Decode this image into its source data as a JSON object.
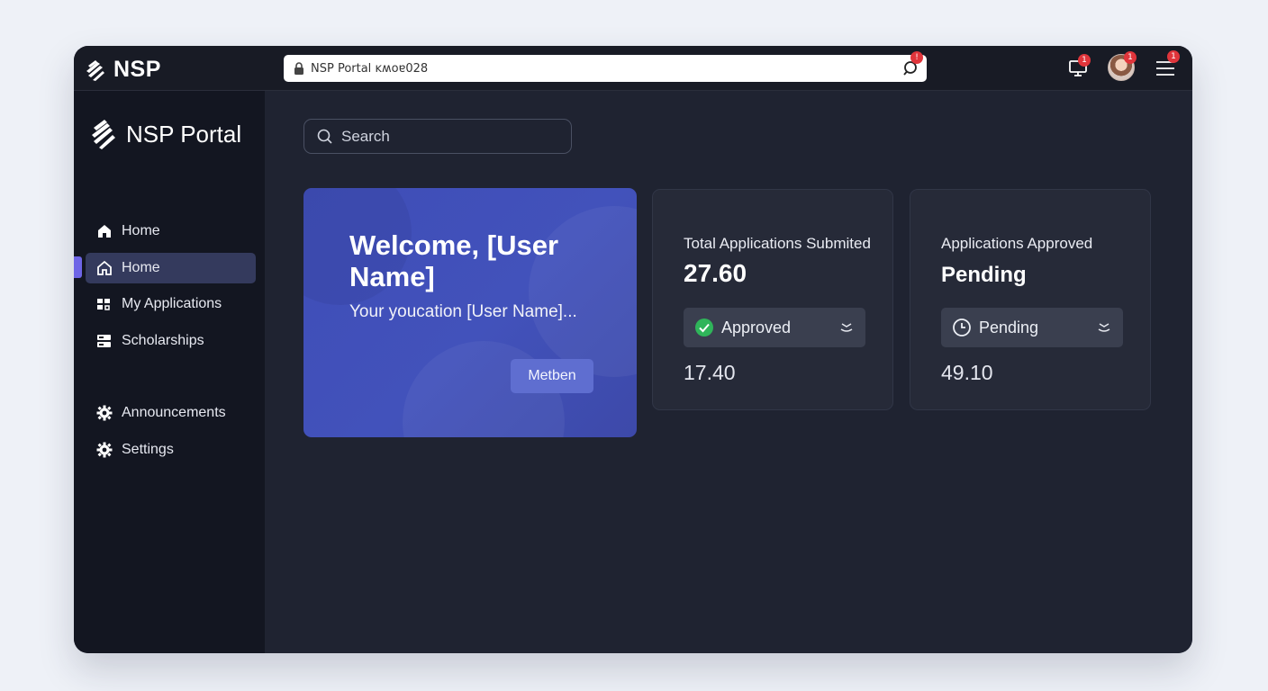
{
  "topbar": {
    "brand": "NSP",
    "address": "NSP Portal",
    "address_suffix": "ĸʍοɐ028",
    "search_badge": "!",
    "notifications_badge": "1",
    "avatar_badge": "1",
    "menu_badge": "1"
  },
  "sidebar": {
    "brand": "NSP Portal",
    "items": [
      {
        "label": "Home"
      },
      {
        "label": "Home"
      },
      {
        "label": "My Applications"
      },
      {
        "label": "Scholarships"
      },
      {
        "label": "Announcements"
      },
      {
        "label": "Settings"
      }
    ]
  },
  "main": {
    "search_placeholder": "Search",
    "welcome": {
      "title": "Welcome, [User Name]",
      "subtitle": "Your youcation [User Name]...",
      "button": "Metben"
    },
    "cards": [
      {
        "label": "Total Applications Submited",
        "value": "27.60",
        "select": "Approved",
        "sub_value": "17.40"
      },
      {
        "label": "Applications Approved",
        "value": "Pending",
        "select": "Pending",
        "sub_value": "49.10"
      }
    ]
  },
  "colors": {
    "accent": "#6e65e6",
    "welcome_card": "#4252bb",
    "badge": "#e0353b",
    "approved": "#2fb55a"
  }
}
